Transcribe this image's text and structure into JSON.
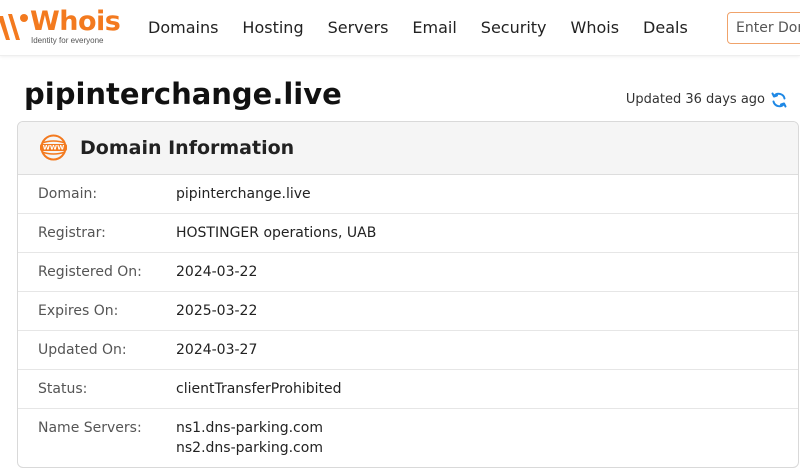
{
  "header": {
    "logo": {
      "word": "Whois",
      "tagline": "Identity for everyone"
    },
    "nav": [
      "Domains",
      "Hosting",
      "Servers",
      "Email",
      "Security",
      "Whois",
      "Deals"
    ],
    "search": {
      "placeholder": "Enter Domain or IP",
      "value": ""
    }
  },
  "page": {
    "title": "pipinterchange.live",
    "updated": "Updated 36 days ago"
  },
  "card": {
    "title": "Domain Information",
    "rows": [
      {
        "label": "Domain:",
        "value": "pipinterchange.live"
      },
      {
        "label": "Registrar:",
        "value": "HOSTINGER operations, UAB"
      },
      {
        "label": "Registered On:",
        "value": "2024-03-22"
      },
      {
        "label": "Expires On:",
        "value": "2025-03-22"
      },
      {
        "label": "Updated On:",
        "value": "2024-03-27"
      },
      {
        "label": "Status:",
        "value": "clientTransferProhibited"
      }
    ],
    "name_servers": {
      "label": "Name Servers:",
      "values": [
        "ns1.dns-parking.com",
        "ns2.dns-parking.com"
      ]
    }
  },
  "icons": {
    "logo": "whois-logo-icon",
    "refresh": "refresh-icon",
    "www": "www-globe-icon"
  },
  "colors": {
    "brand": "#f37a1f",
    "refresh": "#1e88e5",
    "card_header": "#f5f5f5"
  }
}
